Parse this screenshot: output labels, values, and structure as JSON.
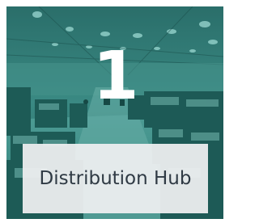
{
  "tile": {
    "number": "1",
    "label": "Distribution Hub",
    "photo_description_icon": "warehouse-image",
    "tint_color": "#2a6f6c",
    "label_box_color": "#eceeef",
    "label_text_color": "#2f3a44"
  }
}
